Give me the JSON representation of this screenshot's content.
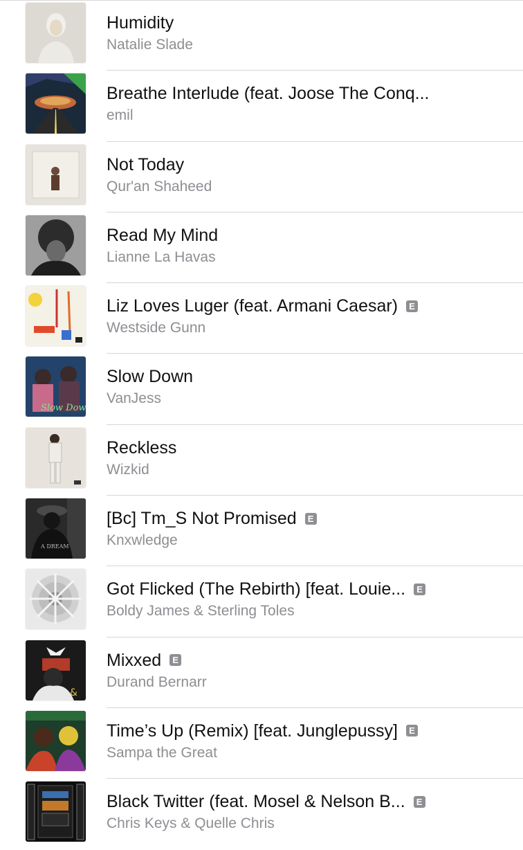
{
  "songs": [
    {
      "title": "Humidity",
      "artist": "Natalie Slade",
      "explicit": false
    },
    {
      "title": "Breathe Interlude (feat. Joose The Conq...",
      "artist": "emil",
      "explicit": false
    },
    {
      "title": "Not Today",
      "artist": "Qur'an Shaheed",
      "explicit": false
    },
    {
      "title": "Read My Mind",
      "artist": "Lianne La Havas",
      "explicit": false
    },
    {
      "title": "Liz Loves Luger (feat. Armani Caesar)",
      "artist": "Westside Gunn",
      "explicit": true
    },
    {
      "title": "Slow Down",
      "artist": "VanJess",
      "explicit": false
    },
    {
      "title": "Reckless",
      "artist": "Wizkid",
      "explicit": false
    },
    {
      "title": "[Bc] Tm_S Not Promised",
      "artist": "Knxwledge",
      "explicit": true
    },
    {
      "title": "Got Flicked (The Rebirth) [feat. Louie...",
      "artist": "Boldy James & Sterling Toles",
      "explicit": true
    },
    {
      "title": "Mixxed",
      "artist": "Durand Bernarr",
      "explicit": true
    },
    {
      "title": "Time’s Up (Remix) [feat. Junglepussy]",
      "artist": "Sampa the Great",
      "explicit": true
    },
    {
      "title": "Black Twitter (feat. Mosel & Nelson B...",
      "artist": "Chris Keys & Quelle Chris",
      "explicit": true
    }
  ],
  "explicit_badge": "E",
  "artwork_text": {
    "knxwledge": "A DREAM",
    "vanjess": "Slow Down"
  }
}
